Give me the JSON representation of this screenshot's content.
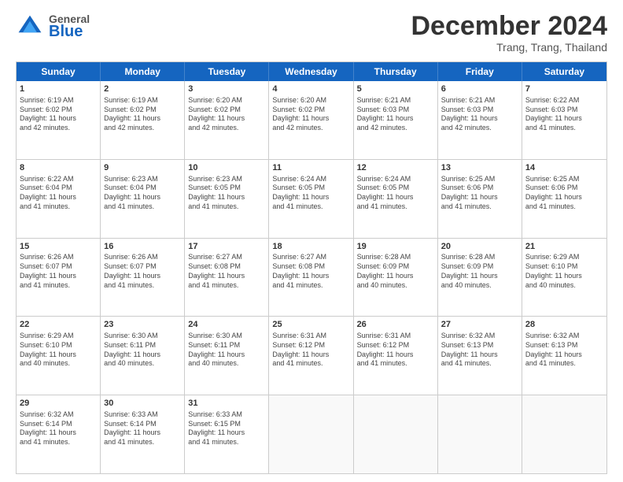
{
  "header": {
    "logo_general": "General",
    "logo_blue": "Blue",
    "month_title": "December 2024",
    "location": "Trang, Trang, Thailand"
  },
  "weekdays": [
    "Sunday",
    "Monday",
    "Tuesday",
    "Wednesday",
    "Thursday",
    "Friday",
    "Saturday"
  ],
  "rows": [
    [
      {
        "day": "1",
        "text": "Sunrise: 6:19 AM\nSunset: 6:02 PM\nDaylight: 11 hours\nand 42 minutes."
      },
      {
        "day": "2",
        "text": "Sunrise: 6:19 AM\nSunset: 6:02 PM\nDaylight: 11 hours\nand 42 minutes."
      },
      {
        "day": "3",
        "text": "Sunrise: 6:20 AM\nSunset: 6:02 PM\nDaylight: 11 hours\nand 42 minutes."
      },
      {
        "day": "4",
        "text": "Sunrise: 6:20 AM\nSunset: 6:02 PM\nDaylight: 11 hours\nand 42 minutes."
      },
      {
        "day": "5",
        "text": "Sunrise: 6:21 AM\nSunset: 6:03 PM\nDaylight: 11 hours\nand 42 minutes."
      },
      {
        "day": "6",
        "text": "Sunrise: 6:21 AM\nSunset: 6:03 PM\nDaylight: 11 hours\nand 42 minutes."
      },
      {
        "day": "7",
        "text": "Sunrise: 6:22 AM\nSunset: 6:03 PM\nDaylight: 11 hours\nand 41 minutes."
      }
    ],
    [
      {
        "day": "8",
        "text": "Sunrise: 6:22 AM\nSunset: 6:04 PM\nDaylight: 11 hours\nand 41 minutes."
      },
      {
        "day": "9",
        "text": "Sunrise: 6:23 AM\nSunset: 6:04 PM\nDaylight: 11 hours\nand 41 minutes."
      },
      {
        "day": "10",
        "text": "Sunrise: 6:23 AM\nSunset: 6:05 PM\nDaylight: 11 hours\nand 41 minutes."
      },
      {
        "day": "11",
        "text": "Sunrise: 6:24 AM\nSunset: 6:05 PM\nDaylight: 11 hours\nand 41 minutes."
      },
      {
        "day": "12",
        "text": "Sunrise: 6:24 AM\nSunset: 6:05 PM\nDaylight: 11 hours\nand 41 minutes."
      },
      {
        "day": "13",
        "text": "Sunrise: 6:25 AM\nSunset: 6:06 PM\nDaylight: 11 hours\nand 41 minutes."
      },
      {
        "day": "14",
        "text": "Sunrise: 6:25 AM\nSunset: 6:06 PM\nDaylight: 11 hours\nand 41 minutes."
      }
    ],
    [
      {
        "day": "15",
        "text": "Sunrise: 6:26 AM\nSunset: 6:07 PM\nDaylight: 11 hours\nand 41 minutes."
      },
      {
        "day": "16",
        "text": "Sunrise: 6:26 AM\nSunset: 6:07 PM\nDaylight: 11 hours\nand 41 minutes."
      },
      {
        "day": "17",
        "text": "Sunrise: 6:27 AM\nSunset: 6:08 PM\nDaylight: 11 hours\nand 41 minutes."
      },
      {
        "day": "18",
        "text": "Sunrise: 6:27 AM\nSunset: 6:08 PM\nDaylight: 11 hours\nand 41 minutes."
      },
      {
        "day": "19",
        "text": "Sunrise: 6:28 AM\nSunset: 6:09 PM\nDaylight: 11 hours\nand 40 minutes."
      },
      {
        "day": "20",
        "text": "Sunrise: 6:28 AM\nSunset: 6:09 PM\nDaylight: 11 hours\nand 40 minutes."
      },
      {
        "day": "21",
        "text": "Sunrise: 6:29 AM\nSunset: 6:10 PM\nDaylight: 11 hours\nand 40 minutes."
      }
    ],
    [
      {
        "day": "22",
        "text": "Sunrise: 6:29 AM\nSunset: 6:10 PM\nDaylight: 11 hours\nand 40 minutes."
      },
      {
        "day": "23",
        "text": "Sunrise: 6:30 AM\nSunset: 6:11 PM\nDaylight: 11 hours\nand 40 minutes."
      },
      {
        "day": "24",
        "text": "Sunrise: 6:30 AM\nSunset: 6:11 PM\nDaylight: 11 hours\nand 40 minutes."
      },
      {
        "day": "25",
        "text": "Sunrise: 6:31 AM\nSunset: 6:12 PM\nDaylight: 11 hours\nand 41 minutes."
      },
      {
        "day": "26",
        "text": "Sunrise: 6:31 AM\nSunset: 6:12 PM\nDaylight: 11 hours\nand 41 minutes."
      },
      {
        "day": "27",
        "text": "Sunrise: 6:32 AM\nSunset: 6:13 PM\nDaylight: 11 hours\nand 41 minutes."
      },
      {
        "day": "28",
        "text": "Sunrise: 6:32 AM\nSunset: 6:13 PM\nDaylight: 11 hours\nand 41 minutes."
      }
    ],
    [
      {
        "day": "29",
        "text": "Sunrise: 6:32 AM\nSunset: 6:14 PM\nDaylight: 11 hours\nand 41 minutes."
      },
      {
        "day": "30",
        "text": "Sunrise: 6:33 AM\nSunset: 6:14 PM\nDaylight: 11 hours\nand 41 minutes."
      },
      {
        "day": "31",
        "text": "Sunrise: 6:33 AM\nSunset: 6:15 PM\nDaylight: 11 hours\nand 41 minutes."
      },
      {
        "day": "",
        "text": ""
      },
      {
        "day": "",
        "text": ""
      },
      {
        "day": "",
        "text": ""
      },
      {
        "day": "",
        "text": ""
      }
    ]
  ]
}
